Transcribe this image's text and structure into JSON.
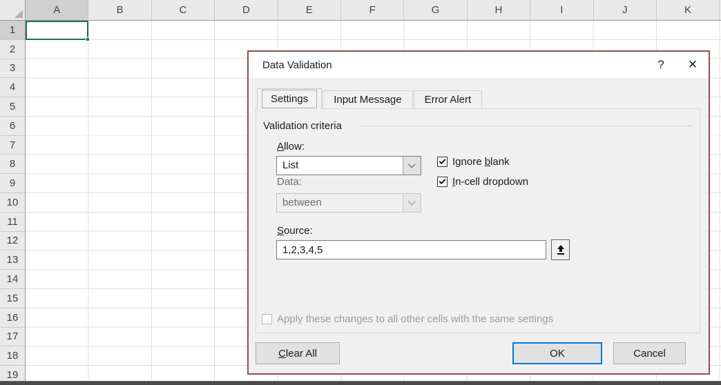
{
  "grid": {
    "columns": [
      "A",
      "B",
      "C",
      "D",
      "E",
      "F",
      "G",
      "H",
      "I",
      "J",
      "K"
    ],
    "rows": [
      "1",
      "2",
      "3",
      "4",
      "5",
      "6",
      "7",
      "8",
      "9",
      "10",
      "11",
      "12",
      "13",
      "14",
      "15",
      "16",
      "17",
      "18",
      "19"
    ],
    "selected_column": "A",
    "selected_row": "1",
    "selected_cell": "A1"
  },
  "dialog": {
    "title": "Data Validation",
    "help_icon": "?",
    "close_icon": "✕",
    "tabs": [
      {
        "label": "Settings",
        "active": true
      },
      {
        "label": "Input Message",
        "active": false
      },
      {
        "label": "Error Alert",
        "active": false
      }
    ],
    "settings": {
      "group_label": "Validation criteria",
      "allow": {
        "label_u": "A",
        "label_post": "llow:",
        "value": "List"
      },
      "ignore_blank": {
        "label_pre": "Ignore ",
        "label_u": "b",
        "label_post": "lank",
        "checked": true
      },
      "incell_dropdown": {
        "label_u": "I",
        "label_post": "n-cell dropdown",
        "checked": true
      },
      "data": {
        "label": "Data:",
        "value": "between",
        "disabled": true
      },
      "source": {
        "label_u": "S",
        "label_post": "ource:",
        "value": "1,2,3,4,5"
      },
      "apply": {
        "label": "Apply these changes to all other cells with the same settings",
        "checked": false,
        "disabled": true
      }
    },
    "buttons": {
      "clear_all": {
        "label_u": "C",
        "label_post": "lear All"
      },
      "ok_label": "OK",
      "cancel_label": "Cancel"
    }
  },
  "colors": {
    "selection_green": "#217346",
    "dialog_border": "#8a5252",
    "default_button_border": "#0078d7"
  }
}
